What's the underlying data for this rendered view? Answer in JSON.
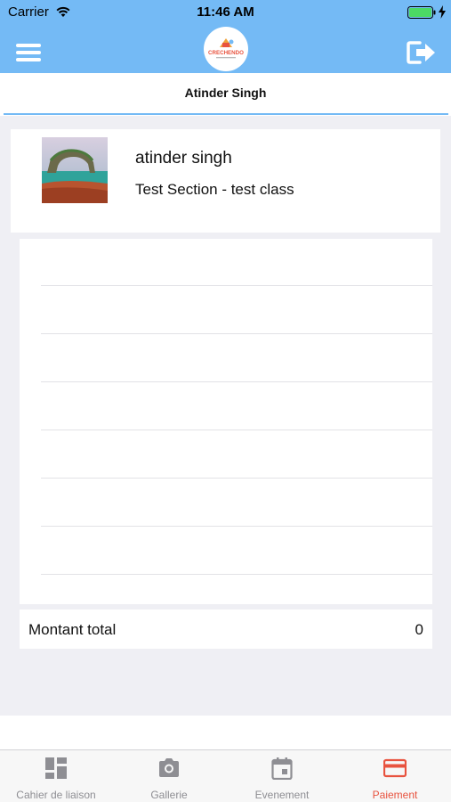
{
  "status_bar": {
    "carrier": "Carrier",
    "time": "11:46 AM"
  },
  "nav": {
    "menu_icon": "hamburger-menu-icon",
    "logo_text": "CRECHENDO",
    "logout_icon": "logout-icon"
  },
  "header": {
    "title": "Atinder Singh"
  },
  "profile": {
    "name": "atinder singh",
    "class_info": "Test Section - test class"
  },
  "summary": {
    "total_label": "Montant total",
    "total_value": "0"
  },
  "tabs": [
    {
      "label": "Cahier de liaison",
      "icon": "dashboard-icon",
      "active": false
    },
    {
      "label": "Gallerie",
      "icon": "camera-icon",
      "active": false
    },
    {
      "label": "Evenement",
      "icon": "calendar-icon",
      "active": false
    },
    {
      "label": "Paiement",
      "icon": "credit-card-icon",
      "active": true
    }
  ],
  "colors": {
    "accent": "#74baf5",
    "active_tab": "#e8533f",
    "inactive_tab": "#8e8e93",
    "battery": "#4cd964"
  }
}
